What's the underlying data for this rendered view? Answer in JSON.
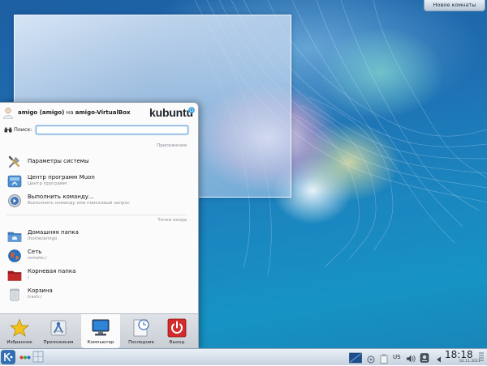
{
  "desktop": {
    "activities_button": "Новое комнаты"
  },
  "launcher": {
    "user": {
      "name": "amigo (amigo)",
      "connector": "на",
      "host": "amigo-VirtualBox"
    },
    "brand": "kubuntu",
    "search": {
      "label": "Поиск:",
      "value": "",
      "placeholder": ""
    },
    "sections": [
      {
        "title": "Приложения",
        "items": [
          {
            "title": "Параметры системы",
            "subtitle": "",
            "icon": "system-settings-icon"
          },
          {
            "title": "Центр программ Muon",
            "subtitle": "Центр программ",
            "icon": "muon-software-center-icon"
          },
          {
            "title": "Выполнить команду...",
            "subtitle": "Выполнить команду или поисковый запрос",
            "icon": "run-command-icon"
          }
        ]
      },
      {
        "title": "Точки входа",
        "items": [
          {
            "title": "Домашняя папка",
            "subtitle": "/home/amigo",
            "icon": "home-folder-icon"
          },
          {
            "title": "Сеть",
            "subtitle": "remote:/",
            "icon": "network-globe-icon"
          },
          {
            "title": "Корневая папка",
            "subtitle": "/",
            "icon": "root-folder-icon"
          },
          {
            "title": "Корзина",
            "subtitle": "trash:/",
            "icon": "trash-icon"
          }
        ]
      }
    ],
    "tabs": [
      {
        "label": "Избранное",
        "icon": "favorites-star-icon",
        "active": false
      },
      {
        "label": "Приложения",
        "icon": "applications-icon",
        "active": false
      },
      {
        "label": "Компьютер",
        "icon": "computer-icon",
        "active": true
      },
      {
        "label": "Последние",
        "icon": "recent-clock-icon",
        "active": false
      },
      {
        "label": "Выход",
        "icon": "power-icon",
        "active": false
      }
    ]
  },
  "panel": {
    "keyboard_layout": "US",
    "clock": {
      "time": "18:18",
      "date": "02.11.2011"
    }
  },
  "colors": {
    "accent": "#1e90d8",
    "power": "#d32b2b",
    "panel": "#c5d2df"
  }
}
